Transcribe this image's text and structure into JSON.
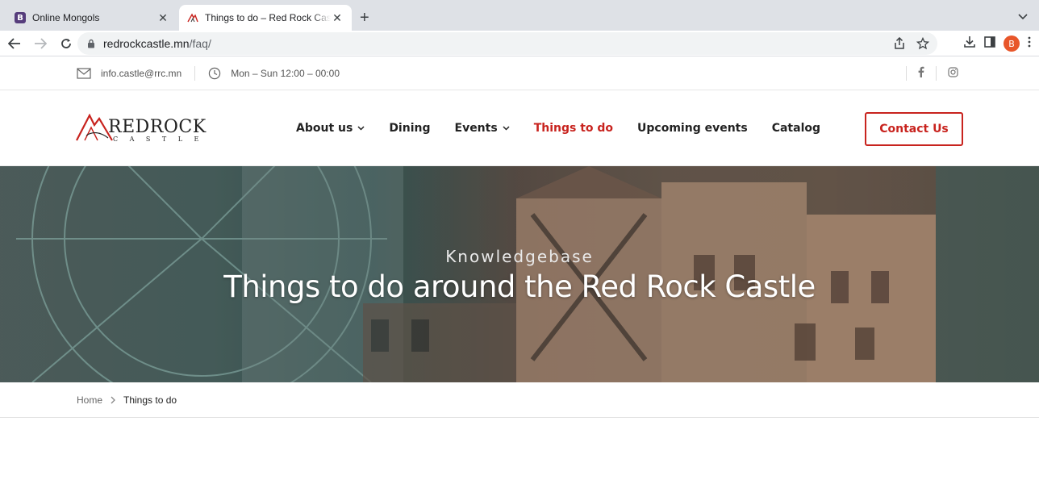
{
  "browser": {
    "tabs": [
      {
        "title": "Online Mongols",
        "favicon": "bootstrap-b-icon",
        "active": false
      },
      {
        "title": "Things to do – Red Rock Castle",
        "favicon": "redrock-logo-icon",
        "active": true
      }
    ],
    "url_host": "redrockcastle.mn",
    "url_path": "/faq/",
    "profile_initial": "B"
  },
  "topbar": {
    "email": "info.castle@rrc.mn",
    "hours": "Mon – Sun 12:00 – 00:00",
    "social": [
      "facebook-icon",
      "instagram-icon"
    ]
  },
  "header": {
    "logo_text": "REDROCK",
    "logo_sub": "CASTLE",
    "nav": [
      {
        "label": "About us",
        "dropdown": true,
        "active": false
      },
      {
        "label": "Dining",
        "dropdown": false,
        "active": false
      },
      {
        "label": "Events",
        "dropdown": true,
        "active": false
      },
      {
        "label": "Things to do",
        "dropdown": false,
        "active": true
      },
      {
        "label": "Upcoming events",
        "dropdown": false,
        "active": false
      },
      {
        "label": "Catalog",
        "dropdown": false,
        "active": false
      }
    ],
    "cta_label": "Contact Us"
  },
  "hero": {
    "kicker": "Knowledgebase",
    "title": "Things to do around the Red Rock Castle"
  },
  "breadcrumb": {
    "home": "Home",
    "current": "Things to do"
  },
  "colors": {
    "accent": "#c8231e",
    "chrome_tabbar": "#dee1e6",
    "omnibox": "#f1f3f4"
  }
}
